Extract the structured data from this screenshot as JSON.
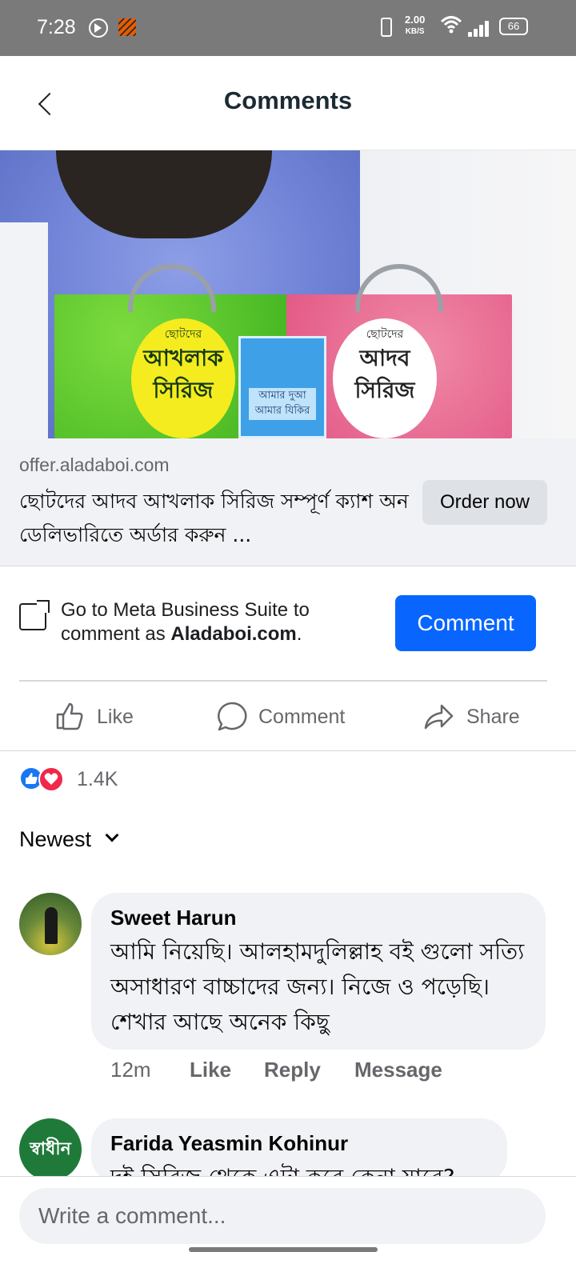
{
  "status_bar": {
    "time": "7:28",
    "net_speed_value": "2.00",
    "net_speed_unit": "KB/S",
    "battery": "66"
  },
  "header": {
    "title": "Comments"
  },
  "ad": {
    "image_texts": {
      "green_small": "ছোটদের",
      "green_title_1": "আখলাক",
      "green_title_2": "সিরিজ",
      "pink_small": "ছোটদের",
      "pink_title_1": "আদব",
      "pink_title_2": "সিরিজ",
      "card_title_1": "আমার দুআ",
      "card_title_2": "আমার যিকির"
    },
    "domain": "offer.aladaboi.com",
    "headline": "ছোটদের আদব আখলাক সিরিজ সম্পূর্ণ ক্যাশ অন ডেলিভারিতে অর্ডার করুন ...",
    "cta_label": "Order now"
  },
  "business_suite": {
    "text_prefix": "Go to Meta Business Suite to comment as ",
    "page_name": "Aladaboi.com",
    "text_suffix": ".",
    "button_label": "Comment"
  },
  "actions": {
    "like": "Like",
    "comment": "Comment",
    "share": "Share"
  },
  "reactions": {
    "count": "1.4K"
  },
  "sort": {
    "label": "Newest"
  },
  "comments": [
    {
      "author": "Sweet Harun",
      "text": "আমি নিয়েছি। আলহামদুলিল্লাহ  বই গুলো সত্যি অসাধারণ বাচ্চাদের জন্য। নিজে ও পড়েছি। শেখার আছে  অনেক  কিছু",
      "time": "12m",
      "like": "Like",
      "reply": "Reply",
      "message": "Message"
    },
    {
      "author": "Farida Yeasmin Kohinur",
      "avatar_text": "স্বাধীন",
      "text": "দুই সিরিজ থেকে এটা করে কেনা যাবে?"
    }
  ],
  "composer": {
    "placeholder": "Write a comment..."
  },
  "colors": {
    "brand_blue": "#0866ff",
    "status_bar": "#7a7a7a",
    "bubble_bg": "#f0f2f5"
  }
}
